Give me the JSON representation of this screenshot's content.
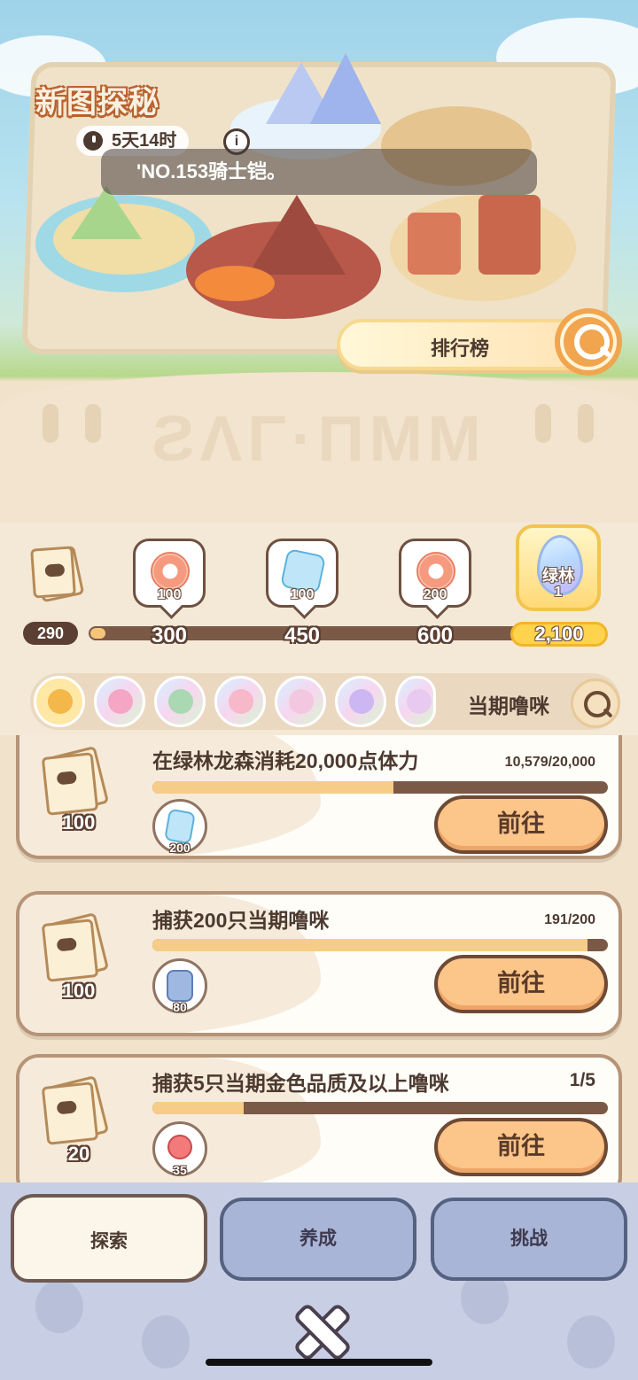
{
  "event": {
    "title": "新图探秘",
    "timer": "5天14时",
    "info_icon": "i",
    "ticker": "'NO.153骑士铠。",
    "rank_button": "排行榜"
  },
  "track": {
    "current_points": "290",
    "progress_fraction": 0.03,
    "milestones": [
      {
        "reward_icon": "donut-icon",
        "reward_qty": "100",
        "threshold": "300"
      },
      {
        "reward_icon": "lightning-icon",
        "reward_qty": "100",
        "threshold": "450"
      },
      {
        "reward_icon": "donut-icon",
        "reward_qty": "200",
        "threshold": "600"
      }
    ],
    "final": {
      "egg_label": "绿林",
      "egg_qty": "1",
      "threshold": "2,100"
    }
  },
  "creatures": {
    "label": "当期噜咪",
    "count": 7
  },
  "tasks": [
    {
      "title": "在绿林龙森消耗20,000点体力",
      "count": "10,579/20,000",
      "progress": 0.529,
      "ticket_qty": "100",
      "item_icon": "lightning-icon",
      "item_qty": "200",
      "button": "前往"
    },
    {
      "title": "捕获200只当期噜咪",
      "count": "191/200",
      "progress": 0.955,
      "ticket_qty": "100",
      "item_icon": "card-icon",
      "item_qty": "80",
      "button": "前往"
    },
    {
      "title": "捕获5只当期金色品质及以上噜咪",
      "count": "1/5",
      "progress": 0.2,
      "ticket_qty": "20",
      "item_icon": "candy-icon",
      "item_qty": "35",
      "button": "前往"
    }
  ],
  "tabs": {
    "explore": "探索",
    "nurture": "养成",
    "challenge": "挑战"
  },
  "colors": {
    "accent_orange": "#fcc58a",
    "bar_fill": "#f6cd88",
    "bar_track": "#7a5a47",
    "tab_inactive": "#a9b5d7"
  }
}
